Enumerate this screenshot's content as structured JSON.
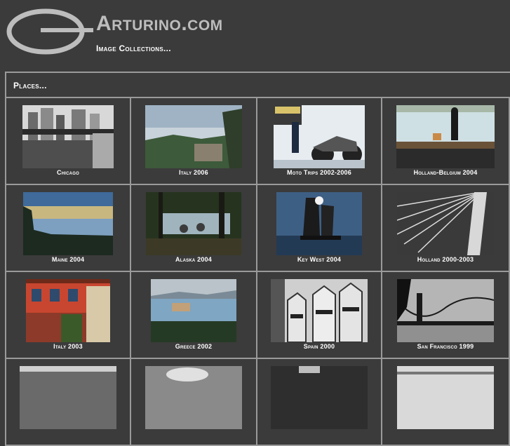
{
  "header": {
    "site_title": "Arturino.com",
    "subtitle": "Image Collections..."
  },
  "panel": {
    "title": "Places..."
  },
  "collections": [
    {
      "label": "Chicago"
    },
    {
      "label": "Italy 2006"
    },
    {
      "label": "Moto Trips 2002-2006"
    },
    {
      "label": "Holland-Belgium 2004"
    },
    {
      "label": "Maine 2004"
    },
    {
      "label": "Alaska 2004"
    },
    {
      "label": "Key West 2004"
    },
    {
      "label": "Holland 2000-2003"
    },
    {
      "label": "Italy 2003"
    },
    {
      "label": "Greece 2002"
    },
    {
      "label": "Spain 2000"
    },
    {
      "label": "San Francisco 1999"
    },
    {
      "label": ""
    },
    {
      "label": ""
    },
    {
      "label": ""
    },
    {
      "label": ""
    }
  ],
  "colors": {
    "background": "#3b3b3b",
    "border": "#9a9a9a",
    "title": "#bdbdbd"
  }
}
